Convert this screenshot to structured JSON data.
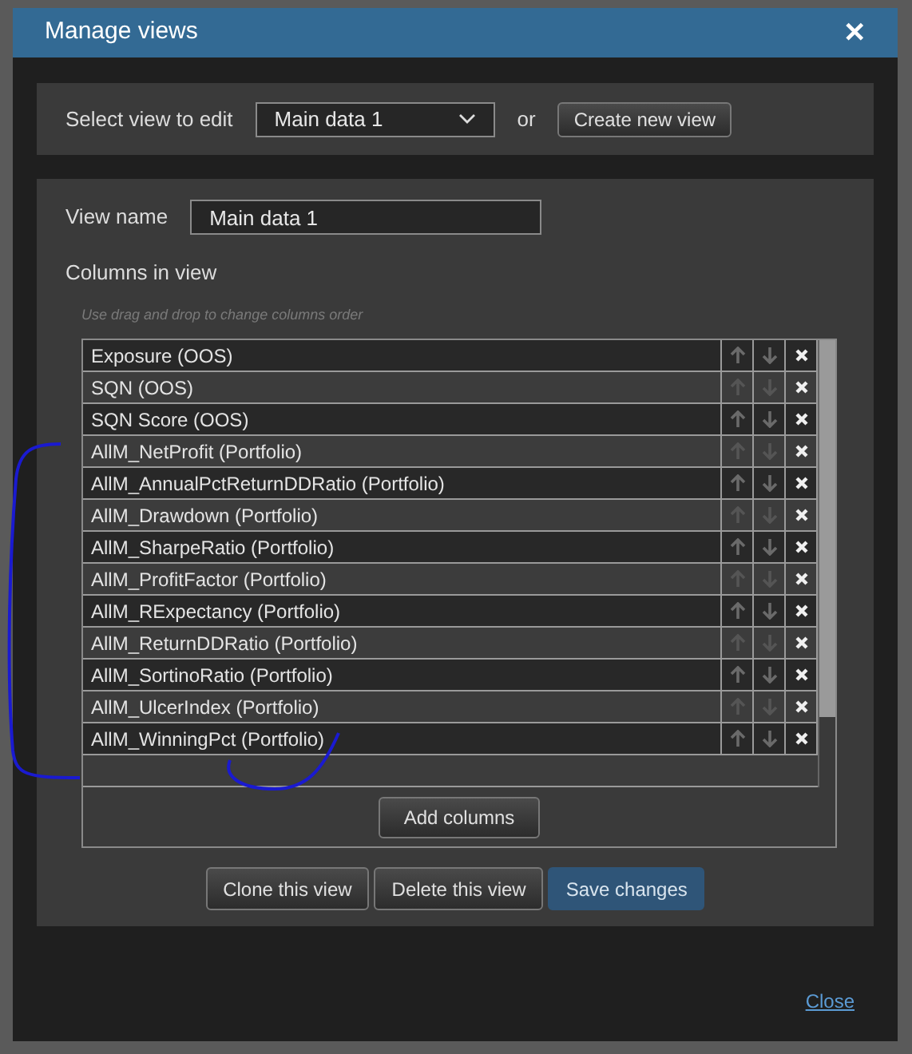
{
  "window": {
    "title": "Manage views",
    "close_icon": "✕"
  },
  "selector": {
    "label": "Select view to edit",
    "value": "Main data 1",
    "or_text": "or",
    "create_button": "Create new view"
  },
  "editor": {
    "name_label": "View name",
    "name_value": "Main data 1",
    "columns_label": "Columns in view",
    "hint": "Use drag and drop to change columns order",
    "columns": [
      {
        "name": "Exposure (OOS)"
      },
      {
        "name": "SQN (OOS)"
      },
      {
        "name": "SQN Score (OOS)"
      },
      {
        "name": "AllM_NetProfit (Portfolio)"
      },
      {
        "name": "AllM_AnnualPctReturnDDRatio (Portfolio)"
      },
      {
        "name": "AllM_Drawdown (Portfolio)"
      },
      {
        "name": "AllM_SharpeRatio (Portfolio)"
      },
      {
        "name": "AllM_ProfitFactor (Portfolio)"
      },
      {
        "name": "AllM_RExpectancy (Portfolio)"
      },
      {
        "name": "AllM_ReturnDDRatio (Portfolio)"
      },
      {
        "name": "AllM_SortinoRatio (Portfolio)"
      },
      {
        "name": "AllM_UlcerIndex (Portfolio)"
      },
      {
        "name": "AllM_WinningPct (Portfolio)"
      }
    ],
    "add_button": "Add columns",
    "buttons": [
      {
        "label": "Clone this view",
        "kind": "default"
      },
      {
        "label": "Delete this view",
        "kind": "default"
      },
      {
        "label": "Save changes",
        "kind": "primary"
      }
    ]
  },
  "footer": {
    "close_link": "Close"
  }
}
